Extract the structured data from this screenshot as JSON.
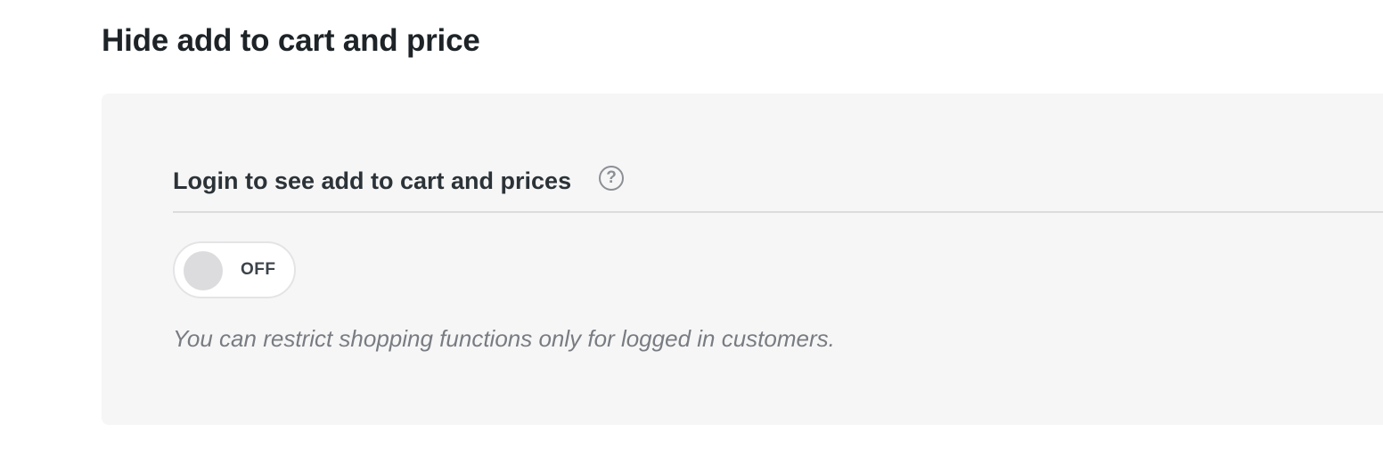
{
  "page": {
    "title": "Hide add to cart and price"
  },
  "setting": {
    "label": "Login to see add to cart and prices",
    "help_icon": "question-mark-icon",
    "help_glyph": "?",
    "toggle": {
      "state": "off",
      "label": "OFF"
    },
    "description": "You can restrict shopping functions only for logged in customers."
  },
  "colors": {
    "card_background": "#f6f6f6",
    "toggle_knob_off": "#dcdcde",
    "description_text": "#787c82"
  }
}
